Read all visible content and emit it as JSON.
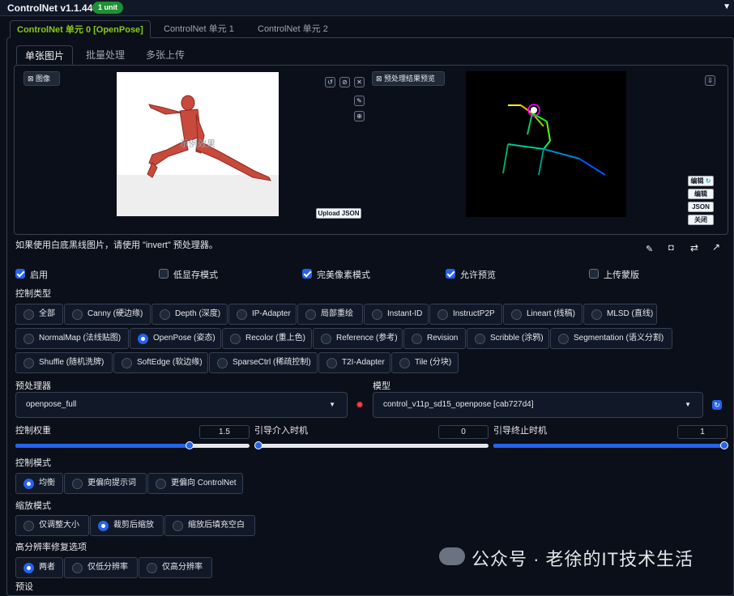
{
  "header": {
    "title": "ControlNet v1.1.445",
    "badge": "1 unit"
  },
  "unit_tabs": [
    "ControlNet 单元 0 [OpenPose]",
    "ControlNet 单元 1",
    "ControlNet 单元 2"
  ],
  "sub_tabs": [
    "单张图片",
    "批量处理",
    "多张上传"
  ],
  "image_panel": {
    "image_label": "图像",
    "preview_label": "预处理结果预览",
    "upload_json": "Upload JSON",
    "edit_btn": "编辑",
    "edit_btn2": "编辑",
    "json_btn": "JSON",
    "close_btn": "关闭",
    "image_watermark": "示例效果"
  },
  "hint": "如果使用白底黑线图片，请使用 \"invert\" 预处理器。",
  "checkboxes": [
    {
      "label": "启用",
      "checked": true
    },
    {
      "label": "低显存模式",
      "checked": false
    },
    {
      "label": "完美像素模式",
      "checked": true
    },
    {
      "label": "允许预览",
      "checked": true
    },
    {
      "label": "上传蒙版",
      "checked": false
    }
  ],
  "control_type": {
    "label": "控制类型",
    "options": [
      "全部",
      "Canny (硬边缘)",
      "Depth (深度)",
      "IP-Adapter",
      "局部重绘",
      "Instant-ID",
      "InstructP2P",
      "Lineart (线稿)",
      "MLSD (直线)",
      "NormalMap (法线贴图)",
      "OpenPose (姿态)",
      "Recolor (重上色)",
      "Reference (参考)",
      "Revision",
      "Scribble (涂鸦)",
      "Segmentation (语义分割)",
      "Shuffle (随机洗牌)",
      "SoftEdge (软边缘)",
      "SparseCtrl (稀疏控制)",
      "T2I-Adapter",
      "Tile (分块)"
    ],
    "selected": "OpenPose (姿态)"
  },
  "preprocessor": {
    "label": "预处理器",
    "value": "openpose_full"
  },
  "model": {
    "label": "模型",
    "value": "control_v11p_sd15_openpose [cab727d4]"
  },
  "sliders": [
    {
      "label": "控制权重",
      "value": "1.5",
      "fraction": 0.72
    },
    {
      "label": "引导介入时机",
      "value": "0",
      "fraction": 0.0
    },
    {
      "label": "引导终止时机",
      "value": "1",
      "fraction": 1.0
    }
  ],
  "control_mode": {
    "label": "控制模式",
    "options": [
      "均衡",
      "更偏向提示词",
      "更偏向 ControlNet"
    ],
    "selected": "均衡"
  },
  "resize_mode": {
    "label": "缩放模式",
    "options": [
      "仅调整大小",
      "裁剪后缩放",
      "缩放后填充空白"
    ],
    "selected": "裁剪后缩放"
  },
  "hires": {
    "label": "高分辨率修复选项",
    "options": [
      "两者",
      "仅低分辨率",
      "仅高分辨率"
    ],
    "selected": "两者"
  },
  "preset_label": "预设",
  "watermark": "公众号 · 老徐的IT技术生活",
  "colors": {
    "accent": "#2563eb",
    "active_tab": "#84cc16",
    "badge": "#1f8f36"
  }
}
